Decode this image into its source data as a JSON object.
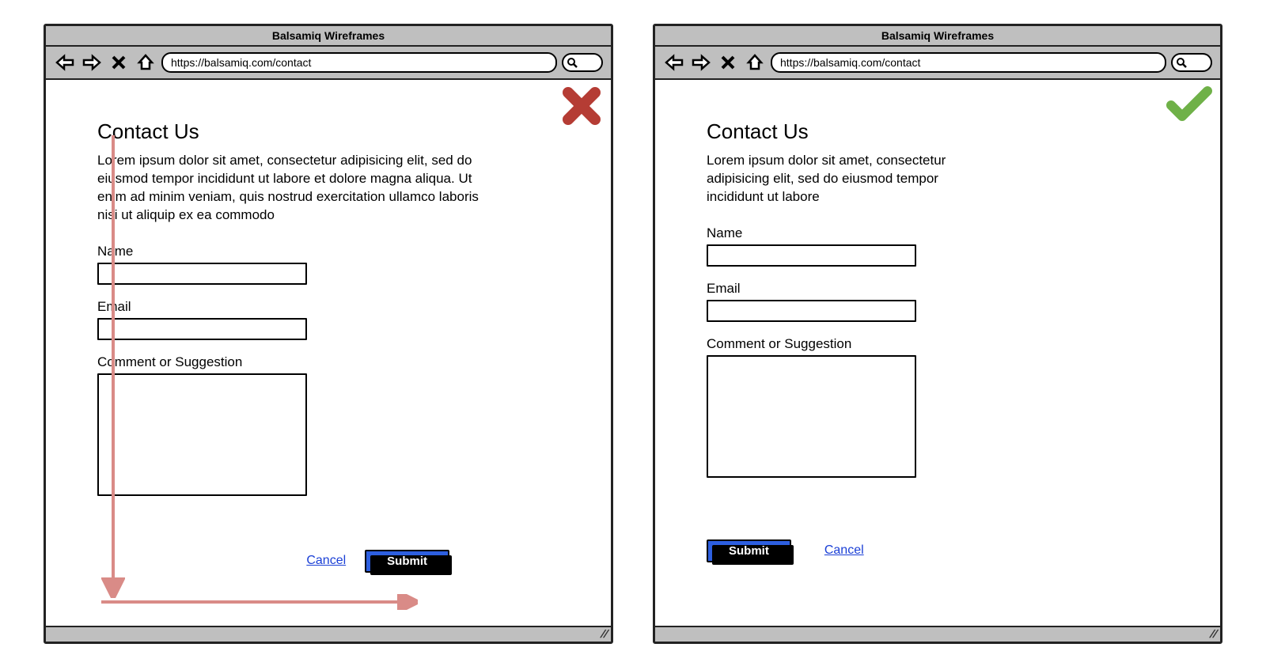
{
  "app_title": "Balsamiq Wireframes",
  "url": "https://balsamiq.com/contact",
  "left": {
    "status": "bad",
    "heading": "Contact Us",
    "intro": "Lorem ipsum dolor sit amet, consectetur adipisicing elit, sed do eiusmod tempor incididunt ut labore et dolore magna aliqua. Ut enim ad minim veniam, quis nostrud exercitation ullamco laboris nisi ut aliquip ex ea commodo",
    "labels": {
      "name": "Name",
      "email": "Email",
      "comment": "Comment or Suggestion"
    },
    "actions": {
      "cancel": "Cancel",
      "submit": "Submit"
    }
  },
  "right": {
    "status": "good",
    "heading": "Contact Us",
    "intro": "Lorem ipsum dolor sit amet, consectetur adipisicing elit, sed do eiusmod tempor incididunt ut labore",
    "labels": {
      "name": "Name",
      "email": "Email",
      "comment": "Comment or Suggestion"
    },
    "actions": {
      "submit": "Submit",
      "cancel": "Cancel"
    }
  },
  "colors": {
    "bad": "#b53c34",
    "good": "#6fb148",
    "primary": "#2d5fe0",
    "arrow": "#d98b87"
  }
}
